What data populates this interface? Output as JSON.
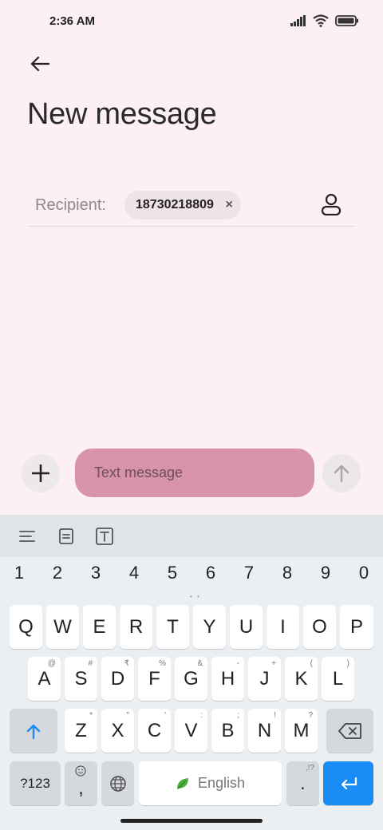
{
  "status": {
    "time": "2:36 AM",
    "icons": [
      "signal-icon",
      "wifi-icon",
      "battery-icon"
    ]
  },
  "header": {
    "back_icon": "back-arrow-icon",
    "title": "New message"
  },
  "recipient": {
    "label": "Recipient:",
    "chip_value": "18730218809",
    "chip_close": "×",
    "contact_icon": "contact-icon"
  },
  "compose": {
    "attach_icon": "plus-icon",
    "placeholder": "Text message",
    "value": "",
    "send_icon": "send-arrow-icon"
  },
  "keyboard": {
    "toolbar": [
      "menu-icon",
      "clipboard-icon",
      "text-edit-icon"
    ],
    "numbers": [
      "1",
      "2",
      "3",
      "4",
      "5",
      "6",
      "7",
      "8",
      "9",
      "0"
    ],
    "row1": [
      "Q",
      "W",
      "E",
      "R",
      "T",
      "Y",
      "U",
      "I",
      "O",
      "P"
    ],
    "row2": [
      "A",
      "S",
      "D",
      "F",
      "G",
      "H",
      "J",
      "K",
      "L"
    ],
    "row2_hints": [
      "@",
      "#",
      "₹",
      "%",
      "&",
      "-",
      "+",
      "(",
      ")"
    ],
    "row3": [
      "Z",
      "X",
      "C",
      "V",
      "B",
      "N",
      "M"
    ],
    "row3_hints": [
      "*",
      "\"",
      "'",
      ":",
      ";",
      "!",
      "?"
    ],
    "symbols_label": "?123",
    "comma_label": ",",
    "space_label": "English",
    "period_label": ".",
    "period_hint": ",!?",
    "accent_color": "#1a8cf5"
  }
}
